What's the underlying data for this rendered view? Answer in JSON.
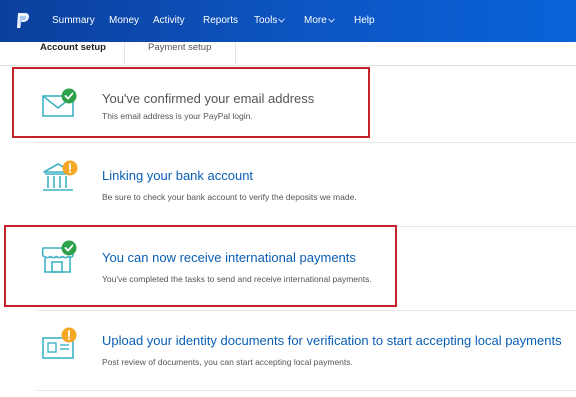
{
  "nav": {
    "items": [
      {
        "label": "Summary"
      },
      {
        "label": "Money"
      },
      {
        "label": "Activity"
      },
      {
        "label": "Reports"
      },
      {
        "label": "Tools",
        "has_caret": true
      },
      {
        "label": "More",
        "has_caret": true
      },
      {
        "label": "Help"
      }
    ],
    "logo_icon": "paypal-logo",
    "background": "#0c56c4"
  },
  "subnav": {
    "tabs": [
      {
        "label": "Account setup",
        "active": true
      },
      {
        "label": "Payment setup",
        "active": false
      }
    ]
  },
  "steps": [
    {
      "title": "You've confirmed your email address",
      "description": "This email address is your PayPal login.",
      "icon": "envelope-icon",
      "status": "complete",
      "status_icon": "green-check-badge",
      "highlighted": true
    },
    {
      "title": "Linking your bank account",
      "description": "Be sure to check your bank account to verify the deposits we made.",
      "icon": "bank-icon",
      "status": "pending",
      "status_icon": "orange-exclamation-badge",
      "highlighted": false
    },
    {
      "title": "You can now receive international payments",
      "description": "You've completed the tasks to send and receive international payments.",
      "icon": "storefront-icon",
      "status": "complete",
      "status_icon": "green-check-badge",
      "highlighted": true
    },
    {
      "title": "Upload your identity documents for verification to start accepting local payments",
      "description": "Post review of documents, you can start accepting local payments.",
      "icon": "id-card-icon",
      "status": "pending",
      "status_icon": "orange-exclamation-badge",
      "highlighted": false
    }
  ],
  "colors": {
    "check": "#2ea24a",
    "alert": "#f5a623",
    "icon_stroke": "#3fb3c4",
    "highlight": "#c4222a",
    "link": "#0a5fb4"
  }
}
